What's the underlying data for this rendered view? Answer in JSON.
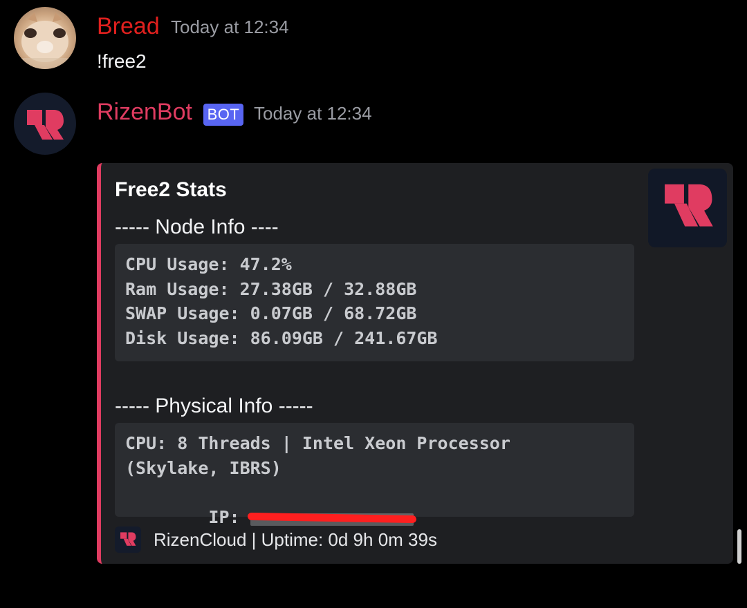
{
  "messages": [
    {
      "username": "Bread",
      "username_color": "#e1201e",
      "timestamp": "Today at 12:34",
      "content": "!free2",
      "avatar": "cat-photo-avatar"
    },
    {
      "username": "RizenBot",
      "username_color": "#e03c61",
      "badge": "BOT",
      "timestamp": "Today at 12:34",
      "avatar": "rizen-logo-avatar"
    }
  ],
  "embed": {
    "accent_color": "#e03c61",
    "title": "Free2 Stats",
    "sections": [
      {
        "heading": "----- Node Info ----",
        "lines": [
          "CPU Usage: 47.2%",
          "Ram Usage: 27.38GB / 32.88GB",
          "SWAP Usage: 0.07GB / 68.72GB",
          "Disk Usage: 86.09GB / 241.67GB"
        ]
      },
      {
        "heading": "----- Physical Info -----",
        "lines": [
          "CPU: 8 Threads | Intel Xeon Processor",
          "(Skylake, IBRS)",
          "IP: "
        ]
      }
    ],
    "footer": "RizenCloud | Uptime: 0d 9h 0m 39s",
    "thumbnail_icon": "rizen-logo-icon"
  },
  "colors": {
    "background": "#000000",
    "embed_bg": "#1e1f22",
    "code_bg": "#2b2d31",
    "bot_badge": "#5865f2",
    "logo_red": "#e03c61",
    "redaction": "#ff1f1f"
  }
}
